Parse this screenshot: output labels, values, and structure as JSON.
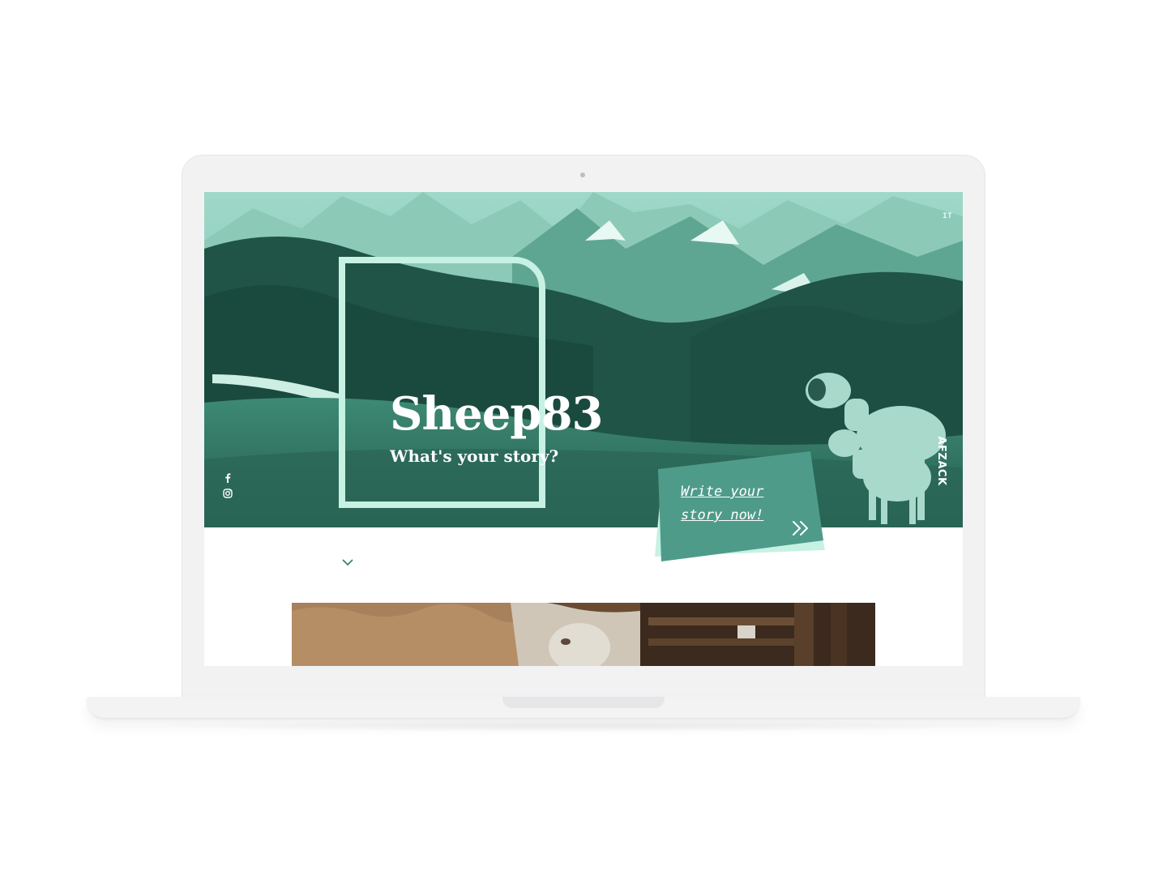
{
  "mockup": {
    "device": "laptop"
  },
  "site": {
    "language_switch": "IT",
    "brand_title": "Sheep83",
    "tagline": "What's your story?",
    "cta_text": "Write your story now!",
    "vertical_logo": "AFZACK",
    "social": [
      {
        "icon": "facebook-icon",
        "label": "f"
      },
      {
        "icon": "instagram-icon"
      }
    ],
    "scroll_icon": "chevron-down-icon"
  },
  "colors": {
    "hero_tint": "#2c6f5f",
    "frame": "#c6f1e3",
    "cta_fill": "#4e9b89",
    "cta_shadow": "#c6f1e3",
    "accent": "#2f7d6c"
  }
}
